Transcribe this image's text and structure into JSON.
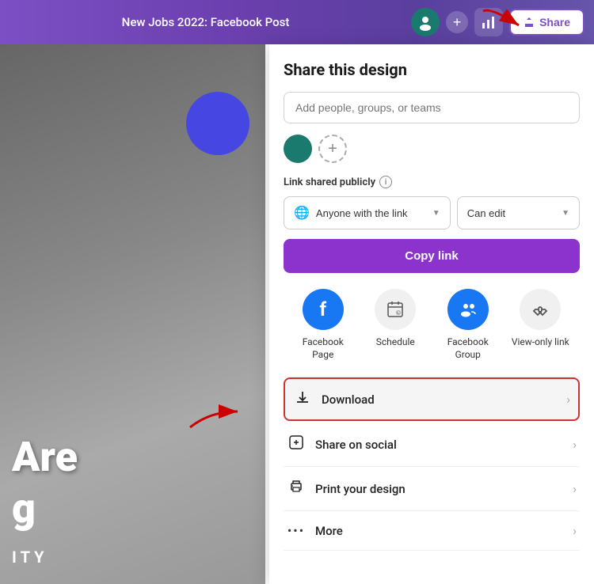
{
  "topbar": {
    "title": "New Jobs 2022: Facebook Post",
    "share_label": "Share"
  },
  "share_panel": {
    "title": "Share this design",
    "add_people_placeholder": "Add people, groups, or teams",
    "link_shared_label": "Link shared publicly",
    "link_dropdown": {
      "option_label": "Anyone with the link",
      "permission_label": "Can edit"
    },
    "copy_link_label": "Copy link",
    "share_options": [
      {
        "id": "facebook-page",
        "label": "Facebook Page",
        "icon": "facebook"
      },
      {
        "id": "schedule",
        "label": "Schedule",
        "icon": "schedule"
      },
      {
        "id": "facebook-group",
        "label": "Facebook Group",
        "icon": "facebook-group"
      },
      {
        "id": "view-only-link",
        "label": "View-only link",
        "icon": "view-link"
      }
    ],
    "action_items": [
      {
        "id": "download",
        "label": "Download",
        "icon": "download",
        "highlighted": true
      },
      {
        "id": "share-social",
        "label": "Share on social",
        "icon": "social"
      },
      {
        "id": "print",
        "label": "Print your design",
        "icon": "print"
      },
      {
        "id": "more",
        "label": "More",
        "icon": "more"
      }
    ]
  },
  "canvas": {
    "text_are": "Are",
    "text_g": "g",
    "text_ity": "ITY"
  }
}
